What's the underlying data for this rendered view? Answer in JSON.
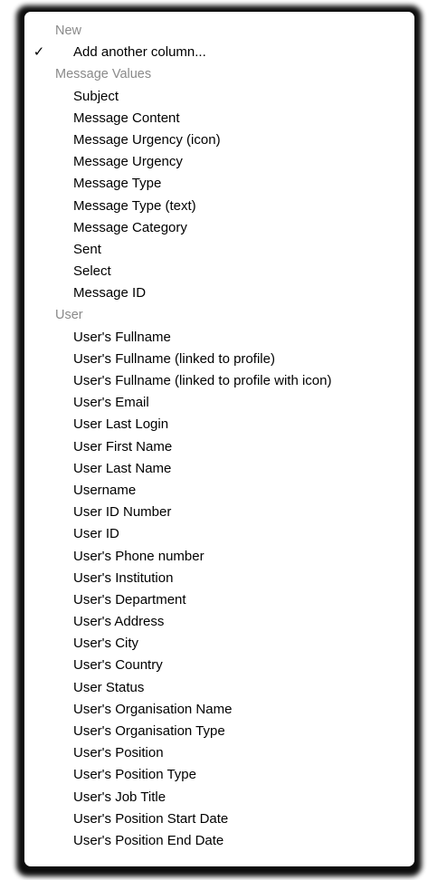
{
  "menu": {
    "groups": [
      {
        "label": "New",
        "items": [
          {
            "label": "Add another column...",
            "checked": true,
            "check_glyph": "✓"
          }
        ]
      },
      {
        "label": "Message Values",
        "items": [
          {
            "label": "Subject"
          },
          {
            "label": "Message Content"
          },
          {
            "label": "Message Urgency (icon)"
          },
          {
            "label": "Message Urgency"
          },
          {
            "label": "Message Type"
          },
          {
            "label": "Message Type (text)"
          },
          {
            "label": "Message Category"
          },
          {
            "label": "Sent"
          },
          {
            "label": "Select"
          },
          {
            "label": "Message ID"
          }
        ]
      },
      {
        "label": "User",
        "items": [
          {
            "label": "User's Fullname"
          },
          {
            "label": "User's Fullname (linked to profile)"
          },
          {
            "label": "User's Fullname (linked to profile with icon)"
          },
          {
            "label": "User's Email"
          },
          {
            "label": "User Last Login"
          },
          {
            "label": "User First Name"
          },
          {
            "label": "User Last Name"
          },
          {
            "label": "Username"
          },
          {
            "label": "User ID Number"
          },
          {
            "label": "User ID"
          },
          {
            "label": "User's Phone number"
          },
          {
            "label": "User's Institution"
          },
          {
            "label": "User's Department"
          },
          {
            "label": "User's Address"
          },
          {
            "label": "User's City"
          },
          {
            "label": "User's Country"
          },
          {
            "label": "User Status"
          },
          {
            "label": "User's Organisation Name"
          },
          {
            "label": "User's Organisation Type"
          },
          {
            "label": "User's Position"
          },
          {
            "label": "User's Position Type"
          },
          {
            "label": "User's Job Title"
          },
          {
            "label": "User's Position Start Date"
          },
          {
            "label": "User's Position End Date"
          }
        ]
      }
    ]
  }
}
